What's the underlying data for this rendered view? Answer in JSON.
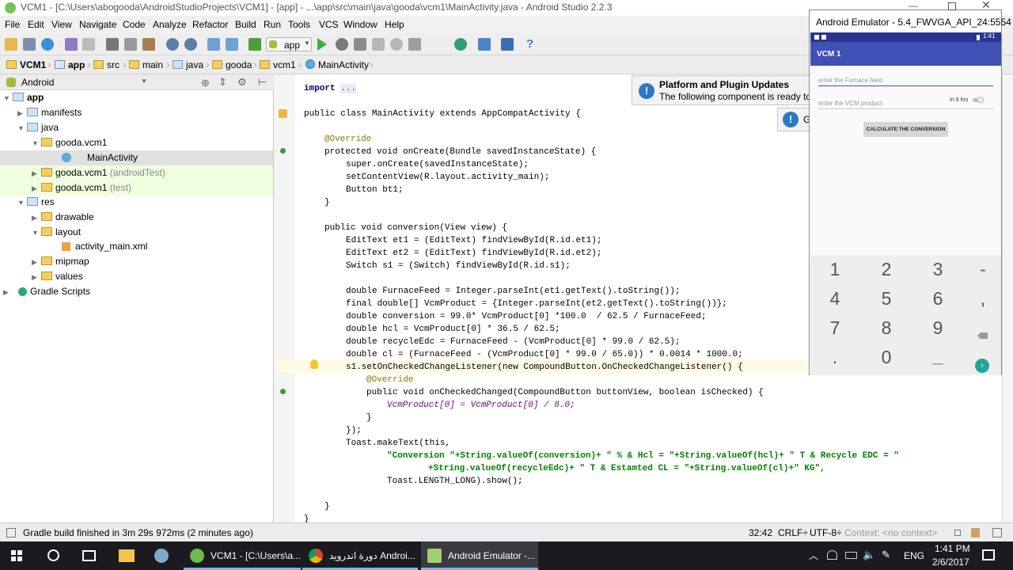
{
  "window": {
    "title": "VCM1 - [C:\\Users\\abogooda\\AndroidStudioProjects\\VCM1] - [app] - ...\\app\\src\\main\\java\\gooda\\vcm1\\MainActivity.java - Android Studio 2.2.3"
  },
  "menu": [
    "File",
    "Edit",
    "View",
    "Navigate",
    "Code",
    "Analyze",
    "Refactor",
    "Build",
    "Run",
    "Tools",
    "VCS",
    "Window",
    "Help"
  ],
  "toolbar": {
    "run_config": "app",
    "help": "?"
  },
  "breadcrumb": [
    "VCM1",
    "app",
    "src",
    "main",
    "java",
    "gooda",
    "vcm1",
    "MainActivity"
  ],
  "project_panel": {
    "view_selector": "Android",
    "tree": [
      {
        "label": "app",
        "suffix": ""
      },
      {
        "label": "manifests",
        "suffix": ""
      },
      {
        "label": "java",
        "suffix": ""
      },
      {
        "label": "gooda.vcm1",
        "suffix": ""
      },
      {
        "label": "MainActivity",
        "suffix": ""
      },
      {
        "label": "gooda.vcm1",
        "suffix": " (androidTest)"
      },
      {
        "label": "gooda.vcm1",
        "suffix": " (test)"
      },
      {
        "label": "res",
        "suffix": ""
      },
      {
        "label": "drawable",
        "suffix": ""
      },
      {
        "label": "layout",
        "suffix": ""
      },
      {
        "label": "activity_main.xml",
        "suffix": ""
      },
      {
        "label": "mipmap",
        "suffix": ""
      },
      {
        "label": "values",
        "suffix": ""
      },
      {
        "label": "Gradle Scripts",
        "suffix": ""
      }
    ]
  },
  "code": {
    "import_kw": "import",
    "import_dots": "...",
    "lines": [
      "public class MainActivity extends AppCompatActivity {",
      "@Override",
      "protected void onCreate(Bundle savedInstanceState) {",
      "super.onCreate(savedInstanceState);",
      "setContentView(R.layout.activity_main);",
      "Button bt1;",
      "}",
      "public void conversion(View view) {",
      "EditText et1 = (EditText) findViewById(R.id.et1);",
      "EditText et2 = (EditText) findViewById(R.id.et2);",
      "Switch s1 = (Switch) findViewById(R.id.s1);",
      "double FurnaceFeed = Integer.parseInt(et1.getText().toString());",
      "final double[] VcmProduct = {Integer.parseInt(et2.getText().toString())};",
      "double conversion = 99.0* VcmProduct[0] *100.0  / 62.5 / FurnaceFeed;",
      "double hcl = VcmProduct[0] * 36.5 / 62.5;",
      "double recycleEdc = FurnaceFeed - (VcmProduct[0] * 99.0 / 62.5);",
      "double cl = (FurnaceFeed - (VcmProduct[0] * 99.0 / 65.0)) * 0.0014 * 1000.0;",
      "s1.setOnCheckedChangeListener(new CompoundButton.OnCheckedChangeListener() {",
      "@Override",
      "public void onCheckedChanged(CompoundButton buttonView, boolean isChecked) {",
      "VcmProduct[0] = VcmProduct[0] / 8.0;",
      "}",
      "});",
      "Toast.makeText(this,",
      "\"Conversion \"+String.valueOf(conversion)+ \" % & Hcl = \"+String.valueOf(hcl)+ \" T & Recycle EDC = \"",
      "+String.valueOf(recycleEdc)+ \" T & Estamted CL = \"+String.valueOf(cl)+\" KG\",",
      "Toast.LENGTH_LONG).show();",
      "}",
      "}"
    ]
  },
  "notification": {
    "title": "Platform and Plugin Updates",
    "body": "The following component is ready to",
    "second_stub": "G"
  },
  "emulator": {
    "title": "Android Emulator - 5.4_FWVGA_API_24:5554",
    "status_time": "1:41",
    "app_title": "VCM 1",
    "hint_feed": "enter the Furnace feed",
    "hint_vcm": "enter the VCM product",
    "switch_label": "In 8 hrs",
    "button": "CALCULATE THE CONVERSION",
    "keys": [
      "1",
      "2",
      "3",
      "-",
      "4",
      "5",
      "6",
      ",",
      "7",
      "8",
      "9",
      "",
      ".",
      "0",
      "_",
      ""
    ]
  },
  "status": {
    "message": "Gradle build finished in 3m 29s 972ms (2 minutes ago)",
    "position": "32:42",
    "line_sep": "CRLF÷",
    "encoding": "UTF-8÷",
    "context": "Context: <no context>"
  },
  "taskbar": {
    "tasks": [
      "VCM1 - [C:\\Users\\a...",
      "دورة اندرويد Androi...",
      "Android Emulator -..."
    ],
    "lang": "ENG",
    "time": "1:41 PM",
    "date": "2/6/2017"
  },
  "colors": {
    "accent": "#3f51b5",
    "accent_dark": "#2a3593",
    "keyword": "#000080",
    "annotation": "#808000",
    "string": "#008000",
    "field": "#660e7a",
    "number": "#0000ff"
  }
}
